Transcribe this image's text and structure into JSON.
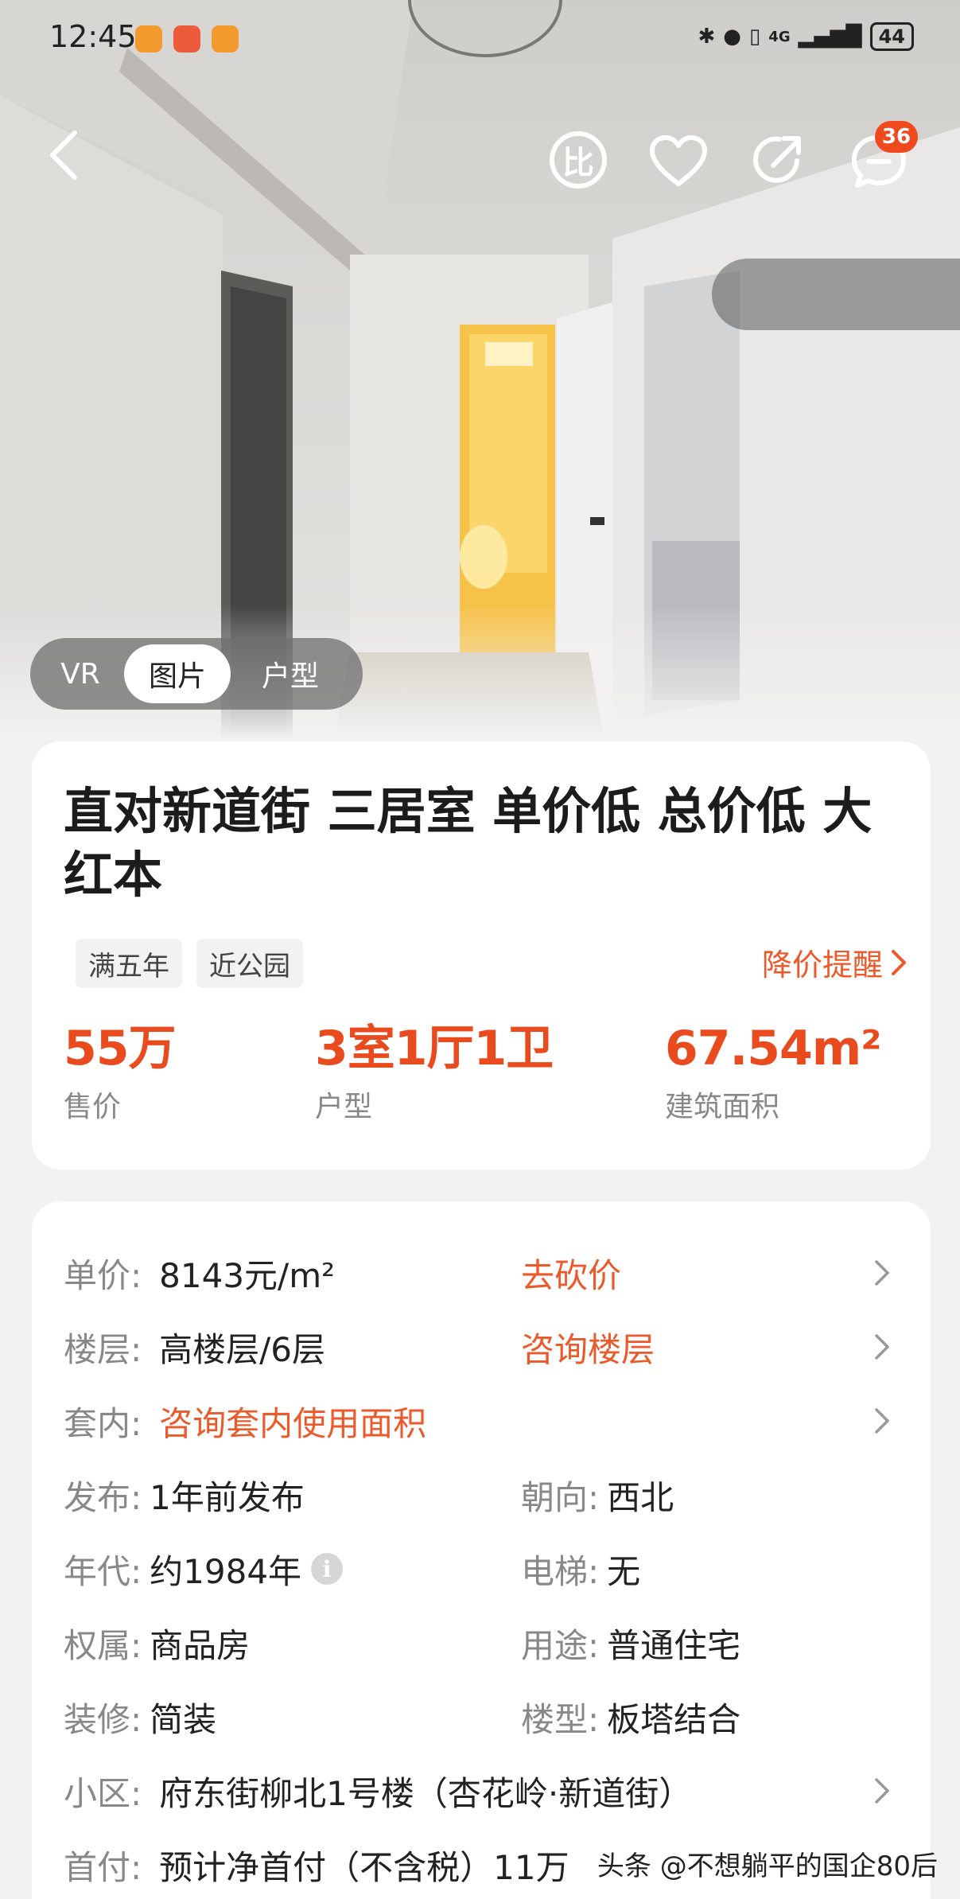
{
  "status_bar": {
    "time": "12:45",
    "network": "4G",
    "battery": "44"
  },
  "header": {
    "compare_label": "比",
    "message_badge": "36"
  },
  "media_tabs": [
    "VR",
    "图片",
    "户型"
  ],
  "listing": {
    "title": "直对新道街 三居室 单价低 总价低 大红本",
    "tags": [
      "满五年",
      "近公园"
    ],
    "price_alert": "降价提醒",
    "stats": [
      {
        "value": "55万",
        "label": "售价"
      },
      {
        "value": "3室1厅1卫",
        "label": "户型"
      },
      {
        "value": "67.54m²",
        "label": "建筑面积"
      }
    ]
  },
  "details": {
    "unit_price": {
      "label": "单价:",
      "value": "8143元/m²",
      "action": "去砍价"
    },
    "floor": {
      "label": "楼层:",
      "value": "高楼层/6层",
      "action": "咨询楼层"
    },
    "inner": {
      "label": "套内:",
      "action": "咨询套内使用面积"
    },
    "published": {
      "label": "发布:",
      "value": "1年前发布"
    },
    "orientation": {
      "label": "朝向:",
      "value": "西北"
    },
    "year": {
      "label": "年代:",
      "value": "约1984年"
    },
    "elevator": {
      "label": "电梯:",
      "value": "无"
    },
    "ownership": {
      "label": "权属:",
      "value": "商品房"
    },
    "usage": {
      "label": "用途:",
      "value": "普通住宅"
    },
    "decoration": {
      "label": "装修:",
      "value": "简装"
    },
    "building_type": {
      "label": "楼型:",
      "value": "板塔结合"
    },
    "community": {
      "label": "小区:",
      "value": "府东街柳北1号楼（杏花岭·新道街）"
    },
    "down_payment": {
      "label": "首付:",
      "value": "预计净首付（不含税）11万"
    }
  },
  "watermark": "头条 @不想躺平的国企80后",
  "colors": {
    "accent": "#ea4b1e",
    "card": "#ffffff",
    "bg": "#f2f2f2"
  }
}
